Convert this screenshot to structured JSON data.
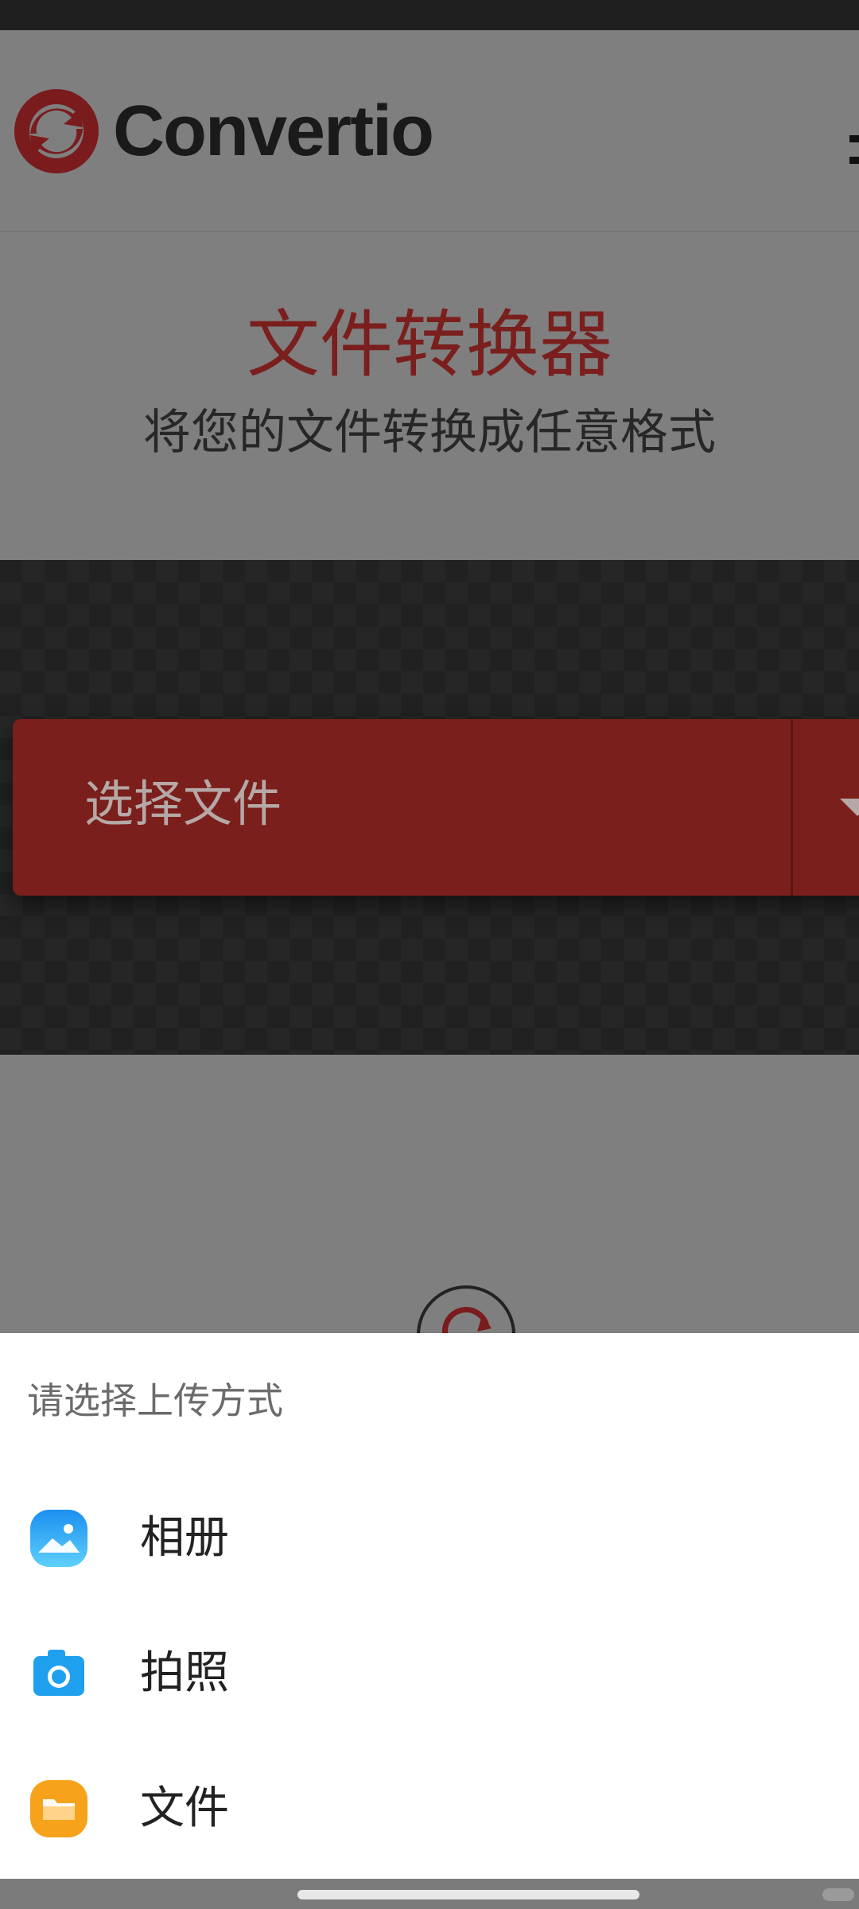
{
  "header": {
    "brand_name": "Convertio",
    "brand_color": "#c0272d"
  },
  "hero": {
    "title": "文件转换器",
    "subtitle": "将您的文件转换成任意格式"
  },
  "upload": {
    "choose_file_label": "选择文件"
  },
  "upload_sheet": {
    "title": "请选择上传方式",
    "options": [
      {
        "label": "相册",
        "icon": "gallery-icon",
        "color": "#2aa6f0"
      },
      {
        "label": "拍照",
        "icon": "camera-icon",
        "color": "#1ea0ef"
      },
      {
        "label": "文件",
        "icon": "folder-icon",
        "color": "#f7a21b"
      }
    ]
  }
}
